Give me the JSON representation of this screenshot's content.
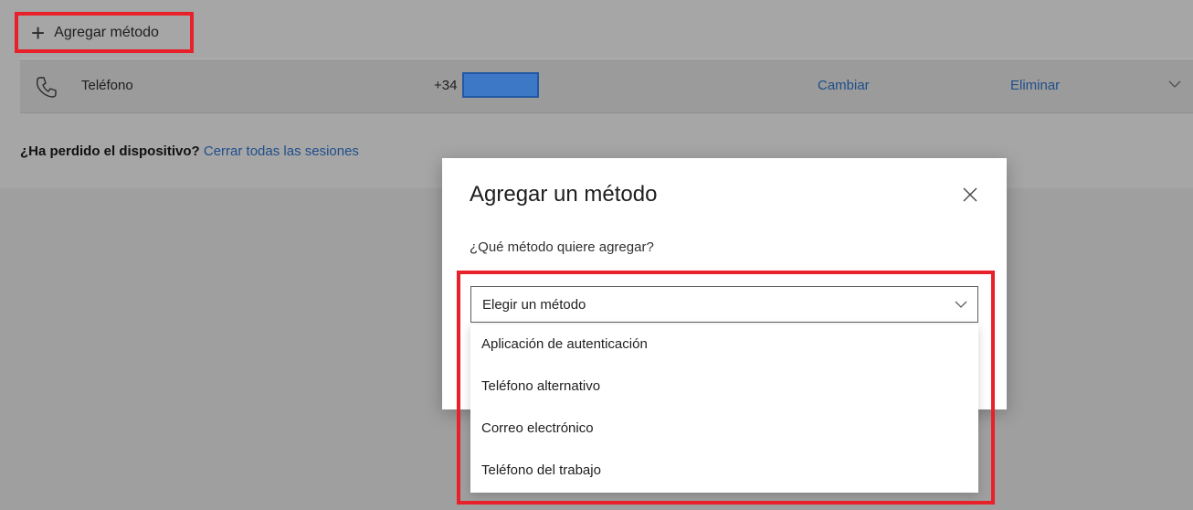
{
  "toolbar": {
    "add_method_label": "Agregar método"
  },
  "method_row": {
    "label": "Teléfono",
    "phone_prefix": "+34",
    "change_label": "Cambiar",
    "delete_label": "Eliminar"
  },
  "lost_device": {
    "question": "¿Ha perdido el dispositivo?",
    "link": "Cerrar todas las sesiones"
  },
  "dialog": {
    "title": "Agregar un método",
    "question": "¿Qué método quiere agregar?",
    "select_value": "Elegir un método",
    "options": [
      "Aplicación de autenticación",
      "Teléfono alternativo",
      "Correo electrónico",
      "Teléfono del trabajo"
    ]
  },
  "colors": {
    "highlight": "#e8202a",
    "link": "#1f4e8a",
    "redaction": "#3c78c6"
  }
}
